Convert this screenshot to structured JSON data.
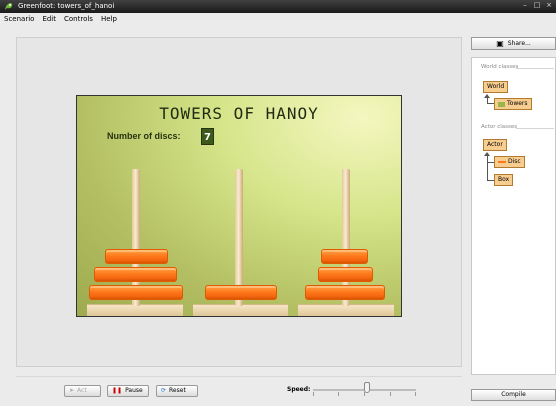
{
  "window": {
    "title": "Greenfoot: towers_of_hanoi"
  },
  "menu": {
    "items": [
      "Scenario",
      "Edit",
      "Controls",
      "Help"
    ]
  },
  "world": {
    "title": "TOWERS OF HANOY",
    "discs_label": "Number of discs:",
    "discs_value": "7",
    "pegs": [
      {
        "disc_count": 3
      },
      {
        "disc_count": 1
      },
      {
        "disc_count": 3
      }
    ]
  },
  "controls": {
    "act_label": "Act",
    "pause_label": "Pause",
    "reset_label": "Reset",
    "speed_label": "Speed:",
    "speed_level": 0.5
  },
  "sidebar": {
    "share_label": "Share...",
    "world_classes_label": "World classes",
    "world_class": "World",
    "world_subclass": "Towers",
    "actor_classes_label": "Actor classes",
    "actor_class": "Actor",
    "actor_subclasses": [
      "Disc",
      "Box"
    ],
    "compile_label": "Compile"
  },
  "colors": {
    "disc": "#ff7a1c",
    "world_bg": "#c3d36f",
    "class_box": "#f8cd90"
  }
}
